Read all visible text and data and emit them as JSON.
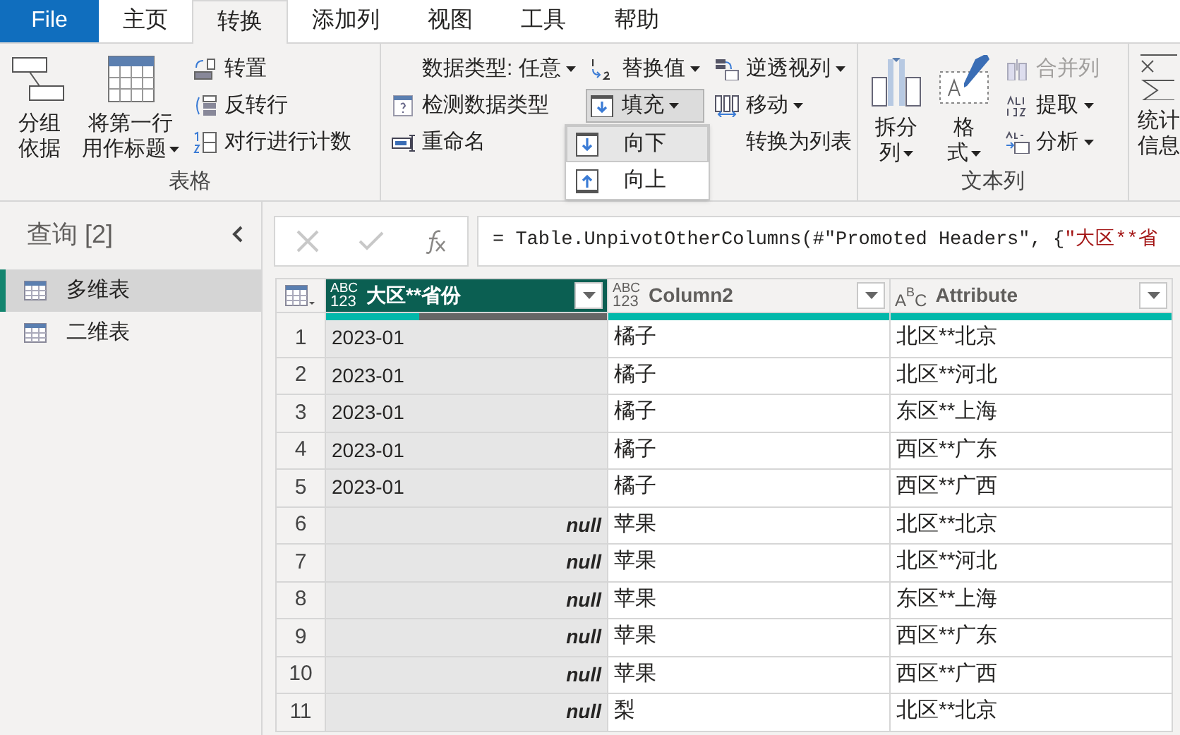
{
  "tabs": [
    {
      "label": "File",
      "kind": "file",
      "selected": false
    },
    {
      "label": "主页",
      "kind": "tab",
      "selected": false
    },
    {
      "label": "转换",
      "kind": "tab",
      "selected": true
    },
    {
      "label": "添加列",
      "kind": "tab",
      "selected": false
    },
    {
      "label": "视图",
      "kind": "tab",
      "selected": false
    },
    {
      "label": "工具",
      "kind": "tab",
      "selected": false
    },
    {
      "label": "帮助",
      "kind": "tab",
      "selected": false
    }
  ],
  "ribbon": {
    "table_group": {
      "label": "表格",
      "large_buttons": [
        {
          "lines": [
            "分组",
            "依据"
          ],
          "dropdown": false
        },
        {
          "lines": [
            "将第一行",
            "用作标题"
          ],
          "dropdown": true
        }
      ],
      "small_buttons": [
        {
          "label": "转置",
          "dropdown": false
        },
        {
          "label": "反转行",
          "dropdown": false
        },
        {
          "label": "对行进行计数",
          "dropdown": false
        }
      ]
    },
    "any_column_group": {
      "columns": [
        [
          {
            "label": "数据类型: 任意",
            "dropdown": true,
            "pressed": false
          },
          {
            "label": "检测数据类型",
            "dropdown": false,
            "pressed": false
          },
          {
            "label": "重命名",
            "dropdown": false,
            "pressed": false
          }
        ],
        [
          {
            "label": "替换值",
            "dropdown": true,
            "pressed": false
          },
          {
            "label": "填充",
            "dropdown": true,
            "pressed": true
          }
        ],
        [
          {
            "label": "逆透视列",
            "dropdown": true,
            "pressed": false
          },
          {
            "label": "移动",
            "dropdown": true,
            "pressed": false
          },
          {
            "label": "转换为列表",
            "dropdown": false,
            "pressed": false
          }
        ]
      ],
      "fill_menu": [
        {
          "label": "向下",
          "selected": true
        },
        {
          "label": "向上",
          "selected": false
        }
      ]
    },
    "text_group": {
      "label": "文本列",
      "large_buttons": [
        {
          "lines": [
            "拆分",
            "列"
          ],
          "dropdown": true
        },
        {
          "lines": [
            "格",
            "式"
          ],
          "dropdown": true
        }
      ],
      "small_buttons": [
        {
          "label": "合并列",
          "dropdown": false,
          "disabled": true
        },
        {
          "label": "提取",
          "dropdown": true,
          "disabled": false
        },
        {
          "label": "分析",
          "dropdown": true,
          "disabled": false
        }
      ]
    },
    "stats_group": {
      "lines": [
        "统计",
        "信息"
      ]
    }
  },
  "queries": {
    "title": "查询 [2]",
    "items": [
      {
        "label": "多维表",
        "selected": true
      },
      {
        "label": "二维表",
        "selected": false
      }
    ]
  },
  "formula": {
    "code": "= Table.UnpivotOtherColumns(#\"Promoted Headers\", {",
    "string": "\"大区**省"
  },
  "table": {
    "columns": [
      {
        "name": "大区**省份",
        "type_icon": {
          "kind": "any",
          "parts": [
            "ABC",
            "123"
          ]
        },
        "selected": true,
        "level": 0.33
      },
      {
        "name": "Column2",
        "type_icon": {
          "kind": "any",
          "parts": [
            "ABC",
            "123"
          ]
        },
        "selected": false,
        "level": 1
      },
      {
        "name": "Attribute",
        "type_icon": {
          "kind": "text",
          "parts": [
            "A",
            "B",
            "C"
          ]
        },
        "selected": false,
        "level": 1
      }
    ],
    "rows": [
      {
        "index": "1",
        "cells": [
          {
            "text": "2023-01",
            "is_null": false
          },
          {
            "text": "橘子",
            "is_null": false
          },
          {
            "text": "北区**北京",
            "is_null": false
          }
        ]
      },
      {
        "index": "2",
        "cells": [
          {
            "text": "2023-01",
            "is_null": false
          },
          {
            "text": "橘子",
            "is_null": false
          },
          {
            "text": "北区**河北",
            "is_null": false
          }
        ]
      },
      {
        "index": "3",
        "cells": [
          {
            "text": "2023-01",
            "is_null": false
          },
          {
            "text": "橘子",
            "is_null": false
          },
          {
            "text": "东区**上海",
            "is_null": false
          }
        ]
      },
      {
        "index": "4",
        "cells": [
          {
            "text": "2023-01",
            "is_null": false
          },
          {
            "text": "橘子",
            "is_null": false
          },
          {
            "text": "西区**广东",
            "is_null": false
          }
        ]
      },
      {
        "index": "5",
        "cells": [
          {
            "text": "2023-01",
            "is_null": false
          },
          {
            "text": "橘子",
            "is_null": false
          },
          {
            "text": "西区**广西",
            "is_null": false
          }
        ]
      },
      {
        "index": "6",
        "cells": [
          {
            "text": "null",
            "is_null": true
          },
          {
            "text": "苹果",
            "is_null": false
          },
          {
            "text": "北区**北京",
            "is_null": false
          }
        ]
      },
      {
        "index": "7",
        "cells": [
          {
            "text": "null",
            "is_null": true
          },
          {
            "text": "苹果",
            "is_null": false
          },
          {
            "text": "北区**河北",
            "is_null": false
          }
        ]
      },
      {
        "index": "8",
        "cells": [
          {
            "text": "null",
            "is_null": true
          },
          {
            "text": "苹果",
            "is_null": false
          },
          {
            "text": "东区**上海",
            "is_null": false
          }
        ]
      },
      {
        "index": "9",
        "cells": [
          {
            "text": "null",
            "is_null": true
          },
          {
            "text": "苹果",
            "is_null": false
          },
          {
            "text": "西区**广东",
            "is_null": false
          }
        ]
      },
      {
        "index": "10",
        "cells": [
          {
            "text": "null",
            "is_null": true
          },
          {
            "text": "苹果",
            "is_null": false
          },
          {
            "text": "西区**广西",
            "is_null": false
          }
        ]
      },
      {
        "index": "11",
        "cells": [
          {
            "text": "null",
            "is_null": true
          },
          {
            "text": "梨",
            "is_null": false
          },
          {
            "text": "北区**北京",
            "is_null": false
          }
        ]
      }
    ]
  }
}
